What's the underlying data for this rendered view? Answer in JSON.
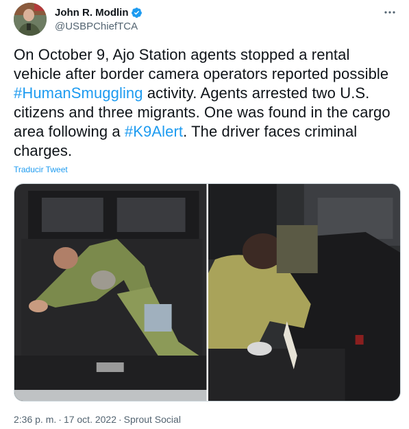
{
  "author": {
    "display_name": "John R. Modlin",
    "handle": "@USBPChiefTCA",
    "verified": true
  },
  "tweet": {
    "text_parts": [
      "On October 9, Ajo Station agents stopped a rental vehicle after border camera operators reported possible ",
      "#HumanSmuggling",
      " activity. Agents arrested two U.S. citizens and three migrants. One was found in the cargo area following a ",
      "#K9Alert",
      ". The driver faces criminal charges."
    ],
    "translate_label": "Traducir Tweet"
  },
  "meta": {
    "time": "2:36 p. m.",
    "separator": "·",
    "date": "17 oct. 2022",
    "source": "Sprout Social"
  },
  "colors": {
    "accent": "#1d9bf0",
    "text": "#0f1419",
    "secondary": "#536471",
    "border": "#cfd9de"
  },
  "icons": {
    "more": "more-options-icon",
    "verified": "verified-badge-icon"
  }
}
